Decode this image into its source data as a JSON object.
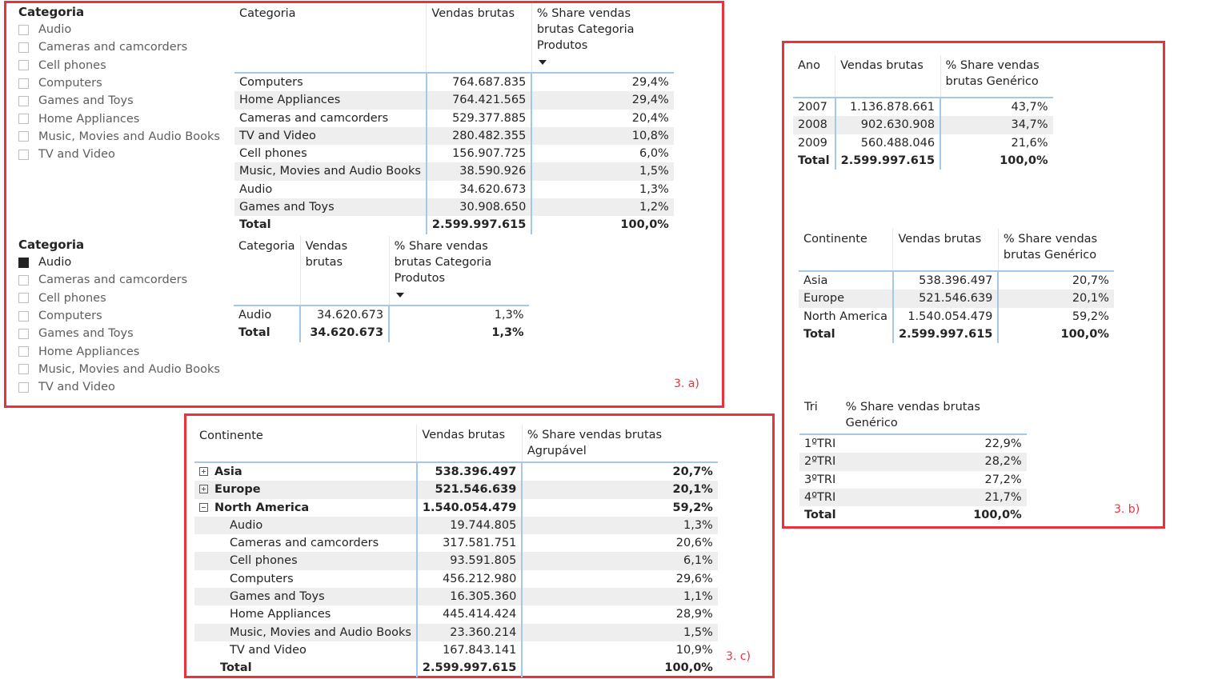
{
  "panel_a": {
    "label": "3. a)",
    "slicer1": {
      "title": "Categoria",
      "items": [
        {
          "label": "Audio",
          "checked": false
        },
        {
          "label": "Cameras and camcorders",
          "checked": false
        },
        {
          "label": "Cell phones",
          "checked": false
        },
        {
          "label": "Computers",
          "checked": false
        },
        {
          "label": "Games and Toys",
          "checked": false
        },
        {
          "label": "Home Appliances",
          "checked": false
        },
        {
          "label": "Music, Movies and Audio Books",
          "checked": false
        },
        {
          "label": "TV and Video",
          "checked": false
        }
      ]
    },
    "table1": {
      "headers": [
        "Categoria",
        "Vendas brutas",
        "% Share vendas brutas Categoria Produtos"
      ],
      "rows": [
        [
          "Computers",
          "764.687.835",
          "29,4%"
        ],
        [
          "Home Appliances",
          "764.421.565",
          "29,4%"
        ],
        [
          "Cameras and camcorders",
          "529.377.885",
          "20,4%"
        ],
        [
          "TV and Video",
          "280.482.355",
          "10,8%"
        ],
        [
          "Cell phones",
          "156.907.725",
          "6,0%"
        ],
        [
          "Music, Movies and Audio Books",
          "38.590.926",
          "1,5%"
        ],
        [
          "Audio",
          "34.620.673",
          "1,3%"
        ],
        [
          "Games and Toys",
          "30.908.650",
          "1,2%"
        ]
      ],
      "total": [
        "Total",
        "2.599.997.615",
        "100,0%"
      ]
    },
    "slicer2": {
      "title": "Categoria",
      "items": [
        {
          "label": "Audio",
          "checked": true
        },
        {
          "label": "Cameras and camcorders",
          "checked": false
        },
        {
          "label": "Cell phones",
          "checked": false
        },
        {
          "label": "Computers",
          "checked": false
        },
        {
          "label": "Games and Toys",
          "checked": false
        },
        {
          "label": "Home Appliances",
          "checked": false
        },
        {
          "label": "Music, Movies and Audio Books",
          "checked": false
        },
        {
          "label": "TV and Video",
          "checked": false
        }
      ]
    },
    "table2": {
      "headers": [
        "Categoria",
        "Vendas brutas",
        "% Share vendas brutas Categoria Produtos"
      ],
      "rows": [
        [
          "Audio",
          "34.620.673",
          "1,3%"
        ]
      ],
      "total": [
        "Total",
        "34.620.673",
        "1,3%"
      ]
    }
  },
  "panel_b": {
    "label": "3. b)",
    "table_ano": {
      "headers": [
        "Ano",
        "Vendas brutas",
        "% Share vendas brutas Genérico"
      ],
      "rows": [
        [
          "2007",
          "1.136.878.661",
          "43,7%"
        ],
        [
          "2008",
          "902.630.908",
          "34,7%"
        ],
        [
          "2009",
          "560.488.046",
          "21,6%"
        ]
      ],
      "total": [
        "Total",
        "2.599.997.615",
        "100,0%"
      ]
    },
    "table_continente": {
      "headers": [
        "Continente",
        "Vendas brutas",
        "% Share vendas brutas Genérico"
      ],
      "rows": [
        [
          "Asia",
          "538.396.497",
          "20,7%"
        ],
        [
          "Europe",
          "521.546.639",
          "20,1%"
        ],
        [
          "North America",
          "1.540.054.479",
          "59,2%"
        ]
      ],
      "total": [
        "Total",
        "2.599.997.615",
        "100,0%"
      ]
    },
    "table_tri": {
      "headers": [
        "Tri",
        "% Share vendas brutas Genérico"
      ],
      "rows": [
        [
          "1ºTRI",
          "22,9%"
        ],
        [
          "2ºTRI",
          "28,2%"
        ],
        [
          "3ºTRI",
          "27,2%"
        ],
        [
          "4ºTRI",
          "21,7%"
        ]
      ],
      "total": [
        "Total",
        "100,0%"
      ]
    }
  },
  "panel_c": {
    "label": "3. c)",
    "headers": [
      "Continente",
      "Vendas brutas",
      "% Share vendas brutas Agrupável"
    ],
    "rows": [
      {
        "level": 0,
        "expander": "plus",
        "cells": [
          "Asia",
          "538.396.497",
          "20,7%"
        ]
      },
      {
        "level": 0,
        "expander": "plus",
        "cells": [
          "Europe",
          "521.546.639",
          "20,1%"
        ]
      },
      {
        "level": 0,
        "expander": "minus",
        "cells": [
          "North America",
          "1.540.054.479",
          "59,2%"
        ]
      },
      {
        "level": 1,
        "cells": [
          "Audio",
          "19.744.805",
          "1,3%"
        ]
      },
      {
        "level": 1,
        "cells": [
          "Cameras and camcorders",
          "317.581.751",
          "20,6%"
        ]
      },
      {
        "level": 1,
        "cells": [
          "Cell phones",
          "93.591.805",
          "6,1%"
        ]
      },
      {
        "level": 1,
        "cells": [
          "Computers",
          "456.212.980",
          "29,6%"
        ]
      },
      {
        "level": 1,
        "cells": [
          "Games and Toys",
          "16.305.360",
          "1,1%"
        ]
      },
      {
        "level": 1,
        "cells": [
          "Home Appliances",
          "445.414.424",
          "28,9%"
        ]
      },
      {
        "level": 1,
        "cells": [
          "Music, Movies and Audio Books",
          "23.360.214",
          "1,5%"
        ]
      },
      {
        "level": 1,
        "cells": [
          "TV and Video",
          "167.843.141",
          "10,9%"
        ]
      }
    ],
    "total": [
      "Total",
      "2.599.997.615",
      "100,0%"
    ]
  }
}
